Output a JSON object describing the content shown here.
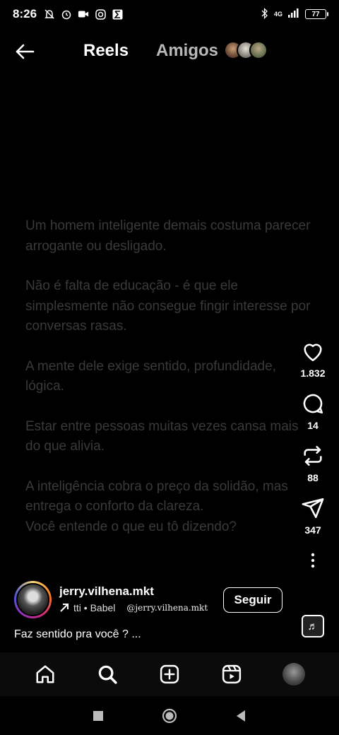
{
  "status_bar": {
    "time": "8:26",
    "network": "4G",
    "battery": "77",
    "icons": [
      "mute-icon",
      "alarm-icon",
      "video-icon",
      "instagram-icon",
      "sigma-icon",
      "bluetooth-icon",
      "signal-icon",
      "battery-icon"
    ]
  },
  "header": {
    "tab_reels": "Reels",
    "tab_friends": "Amigos"
  },
  "reel": {
    "text": [
      "Um homem inteligente demais costuma parecer arrogante ou desligado.",
      "Não é falta de educação - é que ele simplesmente não consegue fingir interesse por conversas rasas.",
      "A mente dele exige sentido, profundidade, lógica.",
      "Estar entre pessoas muitas vezes cansa mais do que alivia.",
      "A inteligência cobra o preço da solidão, mas entrega o conforto da clareza.",
      "Você entende o que eu tô dizendo?"
    ],
    "text_color": "#3a3a3a"
  },
  "actions": {
    "likes": "1.832",
    "comments": "14",
    "reposts": "88",
    "shares": "347"
  },
  "author": {
    "username": "jerry.vilhena.mkt",
    "audio": "tti • Babel",
    "overlay_handle": "@jerry.vilhena.mkt",
    "follow_label": "Seguir"
  },
  "caption": "Faz sentido pra você ? ...",
  "colors": {
    "background": "#000000",
    "secondary_tab": "#b8b8b8"
  }
}
